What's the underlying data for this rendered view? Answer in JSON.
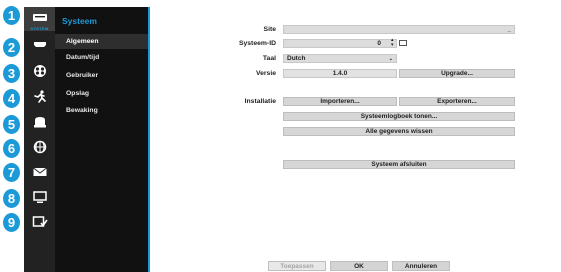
{
  "badges": [
    "1",
    "2",
    "3",
    "4",
    "5",
    "6",
    "7",
    "8",
    "9"
  ],
  "rail": {
    "active_sub_label": "SYSTEM",
    "icons": [
      "system-icon",
      "device-icon",
      "record-icon",
      "event-icon",
      "storage-icon",
      "network-icon",
      "notification-icon",
      "display-icon",
      "status-icon"
    ]
  },
  "submenu": {
    "title": "Systeem",
    "items": [
      {
        "label": "Algemeen",
        "active": true
      },
      {
        "label": "Datum/tijd",
        "active": false
      },
      {
        "label": "Gebruiker",
        "active": false
      },
      {
        "label": "Opslag",
        "active": false
      },
      {
        "label": "Bewaking",
        "active": false
      }
    ]
  },
  "form": {
    "site_label": "Site",
    "site_value": "",
    "system_id_label": "Systeem-ID",
    "system_id_value": "0",
    "language_label": "Taal",
    "language_value": "Dutch",
    "version_label": "Versie",
    "version_value": "1.4.0",
    "upgrade_button": "Upgrade...",
    "installation_label": "Installatie",
    "import_button": "Importeren...",
    "export_button": "Exporteren...",
    "show_log_button": "Systeemlogboek tonen...",
    "clear_data_button": "Alle gegevens wissen",
    "shutdown_button": "Systeem afsluiten"
  },
  "footer": {
    "apply": "Toepassen",
    "ok": "OK",
    "cancel": "Annuleren"
  },
  "colors": {
    "accent": "#1c9ad7",
    "rail_bg": "#222222",
    "submenu_bg": "#111111"
  }
}
